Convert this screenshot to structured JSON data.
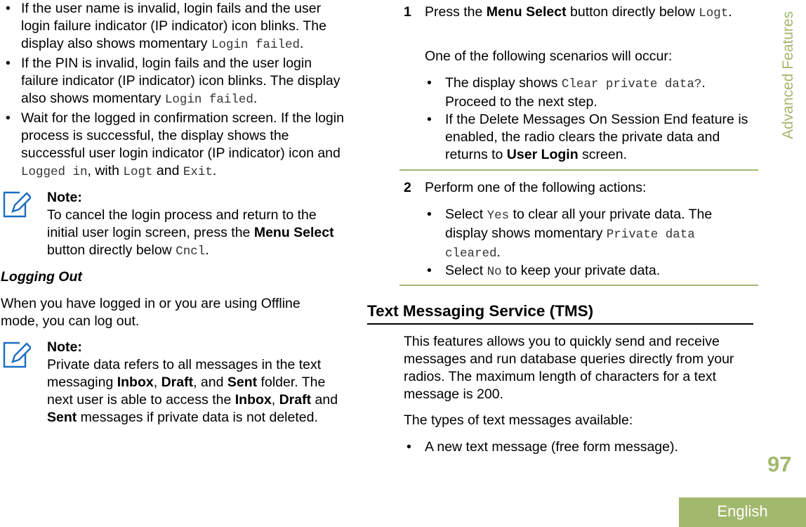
{
  "left": {
    "bullets": [
      [
        [
          "n",
          "If the user name is invalid, login fails and the user login failure indicator (IP indicator) icon blinks. The display also shows momentary "
        ],
        [
          "m",
          "Login failed"
        ],
        [
          "n",
          "."
        ]
      ],
      [
        [
          "n",
          "If the PIN is invalid, login fails and the user login failure indicator (IP indicator) icon blinks. The display also shows momentary "
        ],
        [
          "m",
          "Login failed"
        ],
        [
          "n",
          "."
        ]
      ],
      [
        [
          "n",
          "Wait for the logged in confirmation screen. If the login process is successful, the display shows the successful user login indicator (IP indicator) icon and "
        ],
        [
          "m",
          "Logged in"
        ],
        [
          "n",
          ", with "
        ],
        [
          "m",
          "Logt"
        ],
        [
          "n",
          " and "
        ],
        [
          "m",
          "Exit"
        ],
        [
          "n",
          "."
        ]
      ]
    ],
    "bullet_char": "•",
    "note1": {
      "title": "Note:",
      "text": [
        [
          "n",
          "To cancel the login process and return to the initial user login screen, press the "
        ],
        [
          "b",
          "Menu Select"
        ],
        [
          "n",
          " button directly below "
        ],
        [
          "m",
          "Cncl"
        ],
        [
          "n",
          "."
        ]
      ]
    },
    "logging_out_heading": "Logging Out",
    "logging_out_text": "When you have logged in or you are using Offline mode, you can log out.",
    "note2": {
      "title": "Note:",
      "text": [
        [
          "n",
          "Private data refers to all messages in the text messaging "
        ],
        [
          "b",
          "Inbox"
        ],
        [
          "n",
          ", "
        ],
        [
          "b",
          "Draft"
        ],
        [
          "n",
          ", and "
        ],
        [
          "b",
          "Sent"
        ],
        [
          "n",
          " folder. The next user is able to access the "
        ],
        [
          "b",
          "Inbox"
        ],
        [
          "n",
          ", "
        ],
        [
          "b",
          "Draft"
        ],
        [
          "n",
          " and "
        ],
        [
          "b",
          "Sent"
        ],
        [
          "n",
          " messages if private data is not deleted."
        ]
      ]
    }
  },
  "right": {
    "step1": {
      "num": "1",
      "text": [
        [
          "n",
          "Press the "
        ],
        [
          "b",
          "Menu Select"
        ],
        [
          "n",
          " button directly below "
        ],
        [
          "m",
          "Logt"
        ],
        [
          "n",
          "."
        ]
      ],
      "intro": "One of the following scenarios will occur:",
      "bullets": [
        [
          [
            "n",
            "The display shows "
          ],
          [
            "m",
            "Clear private data?"
          ],
          [
            "n",
            ". Proceed to the next step."
          ]
        ],
        [
          [
            "n",
            "If the Delete Messages On Session End feature is enabled, the radio clears the private data and returns to "
          ],
          [
            "b",
            "User Login"
          ],
          [
            "n",
            " screen."
          ]
        ]
      ]
    },
    "step2": {
      "num": "2",
      "text": [
        [
          "n",
          "Perform one of the following actions:"
        ]
      ],
      "bullets": [
        [
          [
            "n",
            "Select "
          ],
          [
            "m",
            "Yes"
          ],
          [
            "n",
            " to clear all your private data. The display shows momentary "
          ],
          [
            "m",
            "Private data cleared"
          ],
          [
            "n",
            "."
          ]
        ],
        [
          [
            "n",
            "Select "
          ],
          [
            "m",
            "No"
          ],
          [
            "n",
            " to keep your private data."
          ]
        ]
      ]
    },
    "tms_heading": "Text Messaging Service (TMS)",
    "tms_text": "This features allows you to quickly send and receive messages and run database queries directly from your radios. The maximum length of characters for a text message is 200.",
    "tms_types": "The types of text messages available:",
    "tms_bullets": [
      [
        [
          "n",
          "A new text message (free form message)."
        ]
      ]
    ]
  },
  "side_title": "Advanced Features",
  "page_number": "97",
  "language_tab": "English",
  "colors": {
    "accent_green": "#a2b86c",
    "note_icon_blue": "#1b6ec2"
  },
  "icons": {
    "note": "pencil-note-icon"
  }
}
